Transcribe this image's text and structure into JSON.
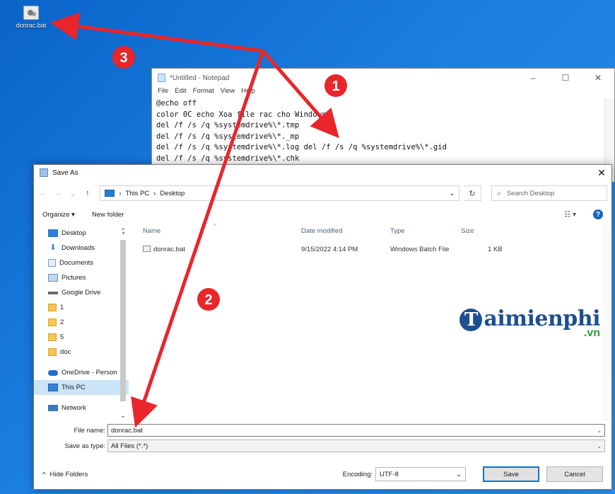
{
  "desktop": {
    "icon_label": "donrac.bat"
  },
  "notepad": {
    "title": "*Untitled - Notepad",
    "window_buttons": [
      "–",
      "☐",
      "✕"
    ],
    "menu": [
      "File",
      "Edit",
      "Format",
      "View",
      "Help"
    ],
    "lines": [
      "@echo off",
      "color 0C echo Xoa file rac cho Windows",
      "del /f /s /q %systemdrive%\\*.tmp",
      "del /f /s /q %systemdrive%\\*._mp",
      "del /f /s /q %systemdrive%\\*.log del /f /s /q %systemdrive%\\*.gid",
      "del /f /s /q %systemdrive%\\*.chk"
    ]
  },
  "dialog": {
    "title": "Save As",
    "close": "✕",
    "address": {
      "segments": [
        "This PC",
        "Desktop"
      ],
      "separator": "›"
    },
    "search_placeholder": "Search Desktop",
    "toolbar": {
      "organize": "Organize ▾",
      "new_folder": "New folder",
      "help": "?"
    },
    "nav_items": [
      {
        "label": "Desktop",
        "icon": "desktop-icon",
        "pinned": true
      },
      {
        "label": "Downloads",
        "icon": "downloads-icon",
        "pinned": true
      },
      {
        "label": "Documents",
        "icon": "documents-icon",
        "pinned": true
      },
      {
        "label": "Pictures",
        "icon": "pictures-icon",
        "pinned": true
      },
      {
        "label": "Google Drive",
        "icon": "drive-icon",
        "pinned": true
      },
      {
        "label": "1",
        "icon": "folder-icon"
      },
      {
        "label": "2",
        "icon": "folder-icon"
      },
      {
        "label": "5",
        "icon": "folder-icon"
      },
      {
        "label": "doc",
        "icon": "folder-icon"
      },
      {
        "label": "OneDrive - Person",
        "icon": "onedrive-icon"
      },
      {
        "label": "This PC",
        "icon": "this-pc-icon",
        "selected": true
      },
      {
        "label": "Network",
        "icon": "network-icon"
      }
    ],
    "columns": {
      "name": "Name",
      "date": "Date modified",
      "type": "Type",
      "size": "Size"
    },
    "files": [
      {
        "name": "donrac.bat",
        "date": "9/15/2022 4:14 PM",
        "type": "Windows Batch File",
        "size": "1 KB"
      }
    ],
    "form": {
      "file_name_label": "File name:",
      "file_name_value": "donrac.bat",
      "save_type_label": "Save as type:",
      "save_type_value": "All Files  (*.*)"
    },
    "footer": {
      "hide_folders": "Hide Folders",
      "encoding_label": "Encoding:",
      "encoding_value": "UTF-8",
      "save": "Save",
      "cancel": "Cancel"
    }
  },
  "watermark": {
    "initial": "T",
    "text": "aimienphi",
    "suffix": ".vn"
  },
  "annotations": {
    "color": "#e8262b",
    "badges": [
      "1",
      "2",
      "3"
    ]
  }
}
